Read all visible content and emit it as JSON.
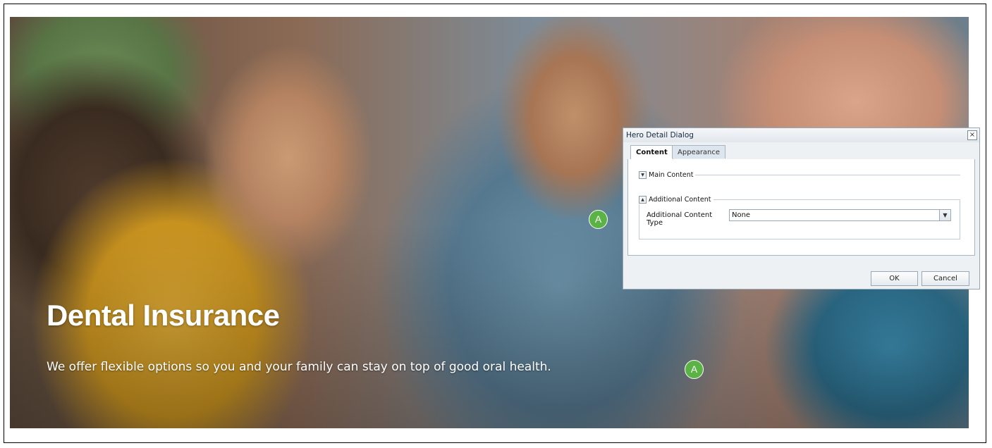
{
  "hero": {
    "title": "Dental Insurance",
    "subtitle": "We offer flexible options so you and your family can stay on top of good oral health."
  },
  "markers": [
    "A",
    "A"
  ],
  "dialog": {
    "title": "Hero Detail Dialog",
    "close_glyph": "×",
    "tabs": [
      {
        "label": "Content",
        "active": true
      },
      {
        "label": "Appearance",
        "active": false
      }
    ],
    "main_section": {
      "label": "Main Content",
      "toggle_glyph": "▼"
    },
    "additional_section": {
      "label": "Additional Content",
      "toggle_glyph": "▲"
    },
    "field": {
      "label": "Additional Content Type",
      "value": "None",
      "arrow_glyph": "▼"
    },
    "ok_label": "OK",
    "cancel_label": "Cancel"
  },
  "colors": {
    "marker": "#5cb345",
    "dialog_bg": "#eef1f4",
    "border": "#99a6b5"
  },
  "icons": [
    "close-icon",
    "expand-toggle-icon",
    "collapse-toggle-icon",
    "chevron-down-icon"
  ]
}
